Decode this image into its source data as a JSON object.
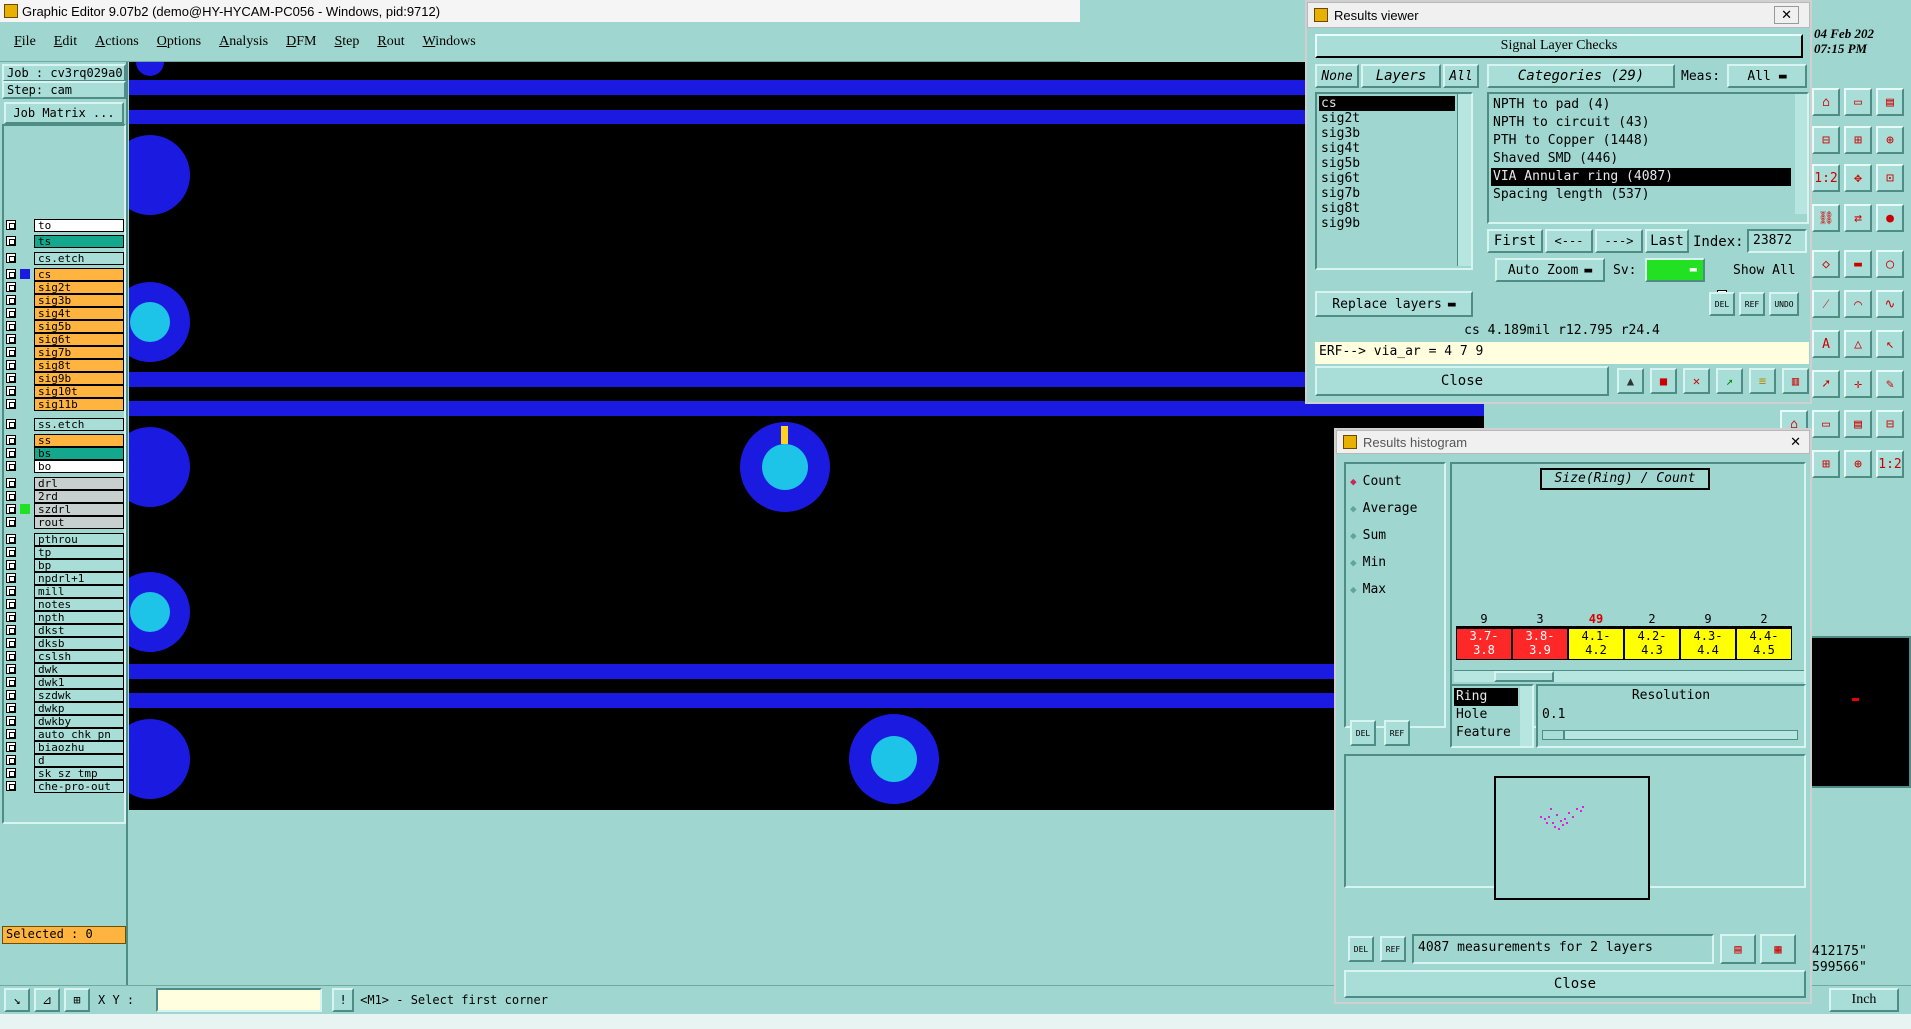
{
  "titlebar": {
    "title": "Graphic Editor 9.07b2 (demo@HY-HYCAM-PC056 - Windows, pid:9712)"
  },
  "menu": [
    "File",
    "Edit",
    "Actions",
    "Options",
    "Analysis",
    "DFM",
    "Step",
    "Rout",
    "Windows"
  ],
  "clock": {
    "date": "04 Feb 202",
    "time": "07:15 PM"
  },
  "job": {
    "job_label": "Job : cv3rq029a0",
    "step_label": "Step: cam",
    "matrix_button": "Job Matrix ..."
  },
  "layers": [
    {
      "name": "to",
      "style": "white"
    },
    {
      "name": "ts",
      "style": "green"
    },
    {
      "name": "cs.etch",
      "style": "teal"
    },
    {
      "name": "cs",
      "style": "orange"
    },
    {
      "name": "sig2t",
      "style": "orange"
    },
    {
      "name": "sig3b",
      "style": "orange"
    },
    {
      "name": "sig4t",
      "style": "orange"
    },
    {
      "name": "sig5b",
      "style": "orange"
    },
    {
      "name": "sig6t",
      "style": "orange"
    },
    {
      "name": "sig7b",
      "style": "orange"
    },
    {
      "name": "sig8t",
      "style": "orange"
    },
    {
      "name": "sig9b",
      "style": "orange"
    },
    {
      "name": "sig10t",
      "style": "orange"
    },
    {
      "name": "sig11b",
      "style": "orange"
    },
    {
      "name": "ss.etch",
      "style": "teal"
    },
    {
      "name": "ss",
      "style": "orange"
    },
    {
      "name": "bs",
      "style": "green"
    },
    {
      "name": "bo",
      "style": "white"
    },
    {
      "name": "drl",
      "style": "gray"
    },
    {
      "name": "2rd",
      "style": "gray"
    },
    {
      "name": "szdrl",
      "style": "gray"
    },
    {
      "name": "rout",
      "style": "gray"
    },
    {
      "name": "pthrou",
      "style": "teal"
    },
    {
      "name": "tp",
      "style": "teal"
    },
    {
      "name": "bp",
      "style": "teal"
    },
    {
      "name": "npdrl+1",
      "style": "teal"
    },
    {
      "name": "mill",
      "style": "teal"
    },
    {
      "name": "notes",
      "style": "teal"
    },
    {
      "name": "npth",
      "style": "teal"
    },
    {
      "name": "dkst",
      "style": "teal"
    },
    {
      "name": "dksb",
      "style": "teal"
    },
    {
      "name": "cslsh",
      "style": "teal"
    },
    {
      "name": "dwk",
      "style": "teal"
    },
    {
      "name": "dwk1",
      "style": "teal"
    },
    {
      "name": "szdwk",
      "style": "teal"
    },
    {
      "name": "dwkp",
      "style": "teal"
    },
    {
      "name": "dwkby",
      "style": "teal"
    },
    {
      "name": "auto_chk_pn",
      "style": "teal"
    },
    {
      "name": "biaozhu",
      "style": "teal"
    },
    {
      "name": "d",
      "style": "teal"
    },
    {
      "name": "sk_sz_tmp",
      "style": "teal"
    },
    {
      "name": "che-pro-out",
      "style": "teal"
    }
  ],
  "status": {
    "selected": "Selected : 0",
    "xy_label": "X Y :",
    "xy_value": "",
    "prompt": "<M1> - Select first corner",
    "units": "Inch",
    "coord_x": "412175\"",
    "coord_y": "599566\""
  },
  "results_viewer": {
    "title": "Results viewer",
    "header": "Signal Layer Checks",
    "none_btn": "None",
    "layers_btn": "Layers",
    "all_btn": "All",
    "categories_btn": "Categories (29)",
    "meas_label": "Meas:",
    "meas_value": "All",
    "layer_list": [
      "cs",
      "sig2t",
      "sig3b",
      "sig4t",
      "sig5b",
      "sig6t",
      "sig7b",
      "sig8t",
      "sig9b"
    ],
    "category_list": [
      "NPTH to pad (4)",
      "NPTH to circuit (43)",
      "PTH to Copper (1448)",
      "Shaved SMD (446)",
      "VIA Annular ring (4087)",
      "Spacing length (537)"
    ],
    "first_btn": "First",
    "prev_btn": "<---",
    "next_btn": "--->",
    "last_btn": "Last",
    "index_label": "Index:",
    "index_value": "23872",
    "auto_zoom": "Auto Zoom",
    "sv_label": "Sv:",
    "show_all": "Show All",
    "replace_layers": "Replace layers",
    "del": "DEL",
    "ref": "REF",
    "undo": "UNDO",
    "info_line": "cs 4.189mil  r12.795  r24.4",
    "erf_line": "ERF--> via_ar = 4 7 9",
    "close": "Close"
  },
  "histogram": {
    "title": "Results histogram",
    "options": [
      "Count",
      "Average",
      "Sum",
      "Min",
      "Max"
    ],
    "selected_option": "Count",
    "chart_title": "Size(Ring) / Count",
    "bins": [
      {
        "count": "9",
        "range_top": "3.7-",
        "range_bottom": "3.8",
        "color": "#ff2828",
        "highlight": false
      },
      {
        "count": "3",
        "range_top": "3.8-",
        "range_bottom": "3.9",
        "color": "#ff2828",
        "highlight": false
      },
      {
        "count": "49",
        "range_top": "4.1-",
        "range_bottom": "4.2",
        "color": "#ffff00",
        "highlight": true
      },
      {
        "count": "2",
        "range_top": "4.2-",
        "range_bottom": "4.3",
        "color": "#ffff00",
        "highlight": false
      },
      {
        "count": "9",
        "range_top": "4.3-",
        "range_bottom": "4.4",
        "color": "#ffff00",
        "highlight": false
      },
      {
        "count": "2",
        "range_top": "4.4-",
        "range_bottom": "4.5",
        "color": "#ffff00",
        "highlight": false
      }
    ],
    "measure_list": [
      "Ring",
      "Hole",
      "Feature"
    ],
    "resolution_label": "Resolution",
    "resolution_value": "0.1",
    "del": "DEL",
    "ref": "REF",
    "summary": "4087 measurements for 2 layers",
    "close": "Close"
  },
  "colors": {
    "canvas": "#000000",
    "copper": "#1a1ae0",
    "drill": "#1ec3e8",
    "panel": "#9fd6cf",
    "selected_bg": "#000000"
  }
}
